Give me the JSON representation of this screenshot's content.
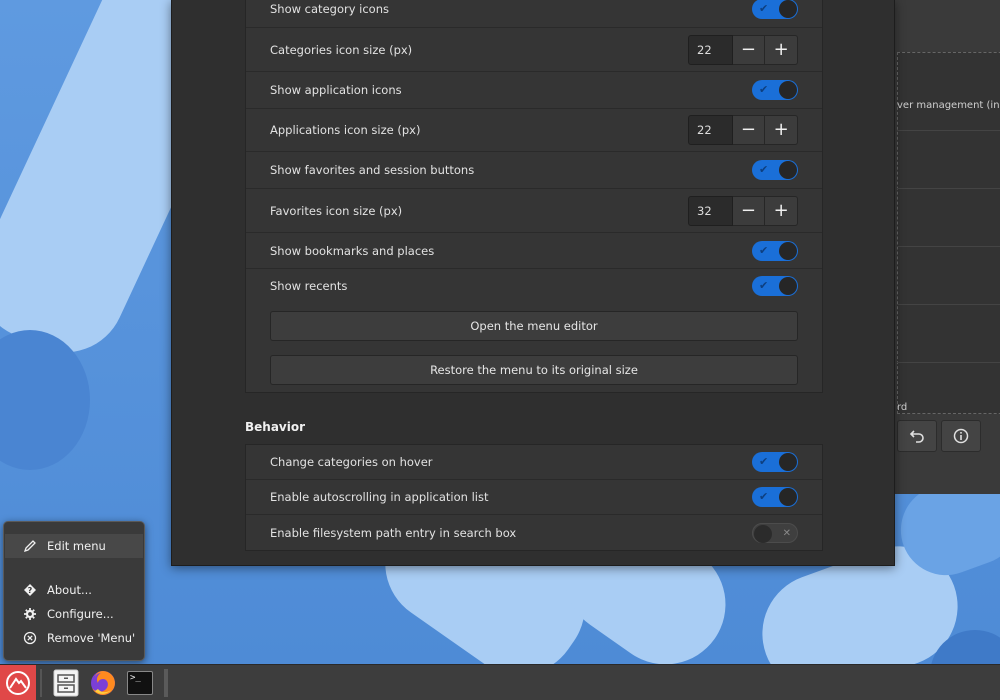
{
  "settings": {
    "rows": [
      {
        "label": "Show category icons",
        "type": "toggle",
        "state": "on"
      },
      {
        "label": "Categories icon size (px)",
        "type": "spin",
        "value": "22"
      },
      {
        "label": "Show application icons",
        "type": "toggle",
        "state": "on"
      },
      {
        "label": "Applications icon size (px)",
        "type": "spin",
        "value": "22"
      },
      {
        "label": "Show favorites and session buttons",
        "type": "toggle",
        "state": "on"
      },
      {
        "label": "Favorites icon size (px)",
        "type": "spin",
        "value": "32"
      },
      {
        "label": "Show bookmarks and places",
        "type": "toggle",
        "state": "on"
      },
      {
        "label": "Show recents",
        "type": "toggle",
        "state": "on"
      }
    ],
    "open_editor_label": "Open the menu editor",
    "restore_size_label": "Restore the menu to its original size",
    "minus_glyph": "−",
    "plus_glyph": "+",
    "toggle_on_glyph": "✔",
    "toggle_off_glyph": "✕"
  },
  "behavior": {
    "heading": "Behavior",
    "rows": [
      {
        "label": "Change categories on hover",
        "type": "toggle",
        "state": "on"
      },
      {
        "label": "Enable autoscrolling in application list",
        "type": "toggle",
        "state": "on"
      },
      {
        "label": "Enable filesystem path entry in search box",
        "type": "toggle",
        "state": "off"
      }
    ]
  },
  "background_window": {
    "text_1": "ver management (includ",
    "text_2": "rd",
    "undo_icon": "undo-icon",
    "info_icon": "info-icon"
  },
  "popup_menu": {
    "items": [
      {
        "label": "Edit menu",
        "icon": "pencil-icon",
        "highlighted": true
      },
      {
        "label": "About...",
        "icon": "about-icon",
        "highlighted": false
      },
      {
        "label": "Configure...",
        "icon": "gear-icon",
        "highlighted": false
      },
      {
        "label": "Remove 'Menu'",
        "icon": "remove-icon",
        "highlighted": false
      }
    ]
  },
  "taskbar": {
    "items": [
      {
        "name": "menu-applet-icon"
      },
      {
        "name": "file-manager-icon"
      },
      {
        "name": "firefox-icon"
      },
      {
        "name": "terminal-icon"
      }
    ],
    "terminal_glyph": ">_"
  },
  "colors": {
    "accent": "#1a6fd8",
    "window_bg": "#2f2f2f",
    "section_bg": "#353535",
    "taskbar_bg": "#3d3d3d",
    "menu_applet_red": "#e04848",
    "wallpaper_blue": "#5b97dd"
  }
}
